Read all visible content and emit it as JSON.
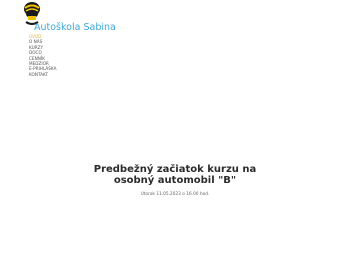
{
  "logo": {
    "icon": "helmet-icon"
  },
  "site": {
    "title": "Autoškola Sabina"
  },
  "nav": {
    "items": [
      {
        "label": "ÚVOD",
        "active": true
      },
      {
        "label": "O NÁS",
        "active": false
      },
      {
        "label": "KURZY",
        "active": false
      },
      {
        "label": "DOCO",
        "active": false
      },
      {
        "label": "CENNÍK",
        "active": false
      },
      {
        "label": "MEDZIOR",
        "active": false
      },
      {
        "label": "E-PRIHLÁŠKA",
        "active": false
      },
      {
        "label": "KONTAKT",
        "active": false
      }
    ]
  },
  "main": {
    "headline_line1": "Predbežný začiatok kurzu na",
    "headline_line2": "osobný automobil \"B\"",
    "date_text": "Utorok 11.05.2023 o 16.00 hod."
  },
  "colors": {
    "title": "#3aa8e0",
    "nav_active": "#e8b23a",
    "nav": "#555555"
  }
}
